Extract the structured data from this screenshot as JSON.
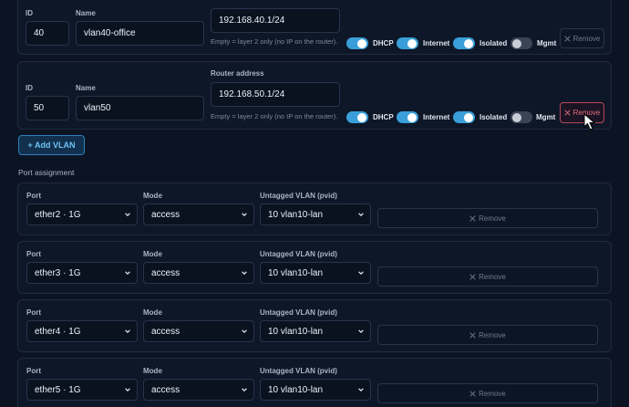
{
  "vlans": [
    {
      "id": "40",
      "name": "vlan40-office",
      "id_label": "ID",
      "name_label": "Name",
      "router_label": "",
      "router_address": "192.168.40.1/24",
      "hint": "Empty = layer 2 only (no IP on the router).",
      "toggles": [
        {
          "label": "DHCP",
          "on": true
        },
        {
          "label": "Internet",
          "on": true
        },
        {
          "label": "Isolated",
          "on": true
        },
        {
          "label": "Mgmt",
          "on": false
        }
      ],
      "remove_label": "Remove"
    },
    {
      "id": "50",
      "name": "vlan50",
      "id_label": "ID",
      "name_label": "Name",
      "router_label": "Router address",
      "router_address": "192.168.50.1/24",
      "hint": "Empty = layer 2 only (no IP on the router).",
      "toggles": [
        {
          "label": "DHCP",
          "on": true
        },
        {
          "label": "Internet",
          "on": true
        },
        {
          "label": "Isolated",
          "on": true
        },
        {
          "label": "Mgmt",
          "on": false
        }
      ],
      "remove_label": "Remove"
    }
  ],
  "add_vlan_label": "+ Add VLAN",
  "port_section_title": "Port assignment",
  "port_labels": {
    "port": "Port",
    "mode": "Mode",
    "pvid": "Untagged VLAN (pvid)"
  },
  "ports": [
    {
      "port": "ether2 · 1G",
      "mode": "access",
      "pvid": "10 vlan10-lan",
      "remove_label": "Remove"
    },
    {
      "port": "ether3 · 1G",
      "mode": "access",
      "pvid": "10 vlan10-lan",
      "remove_label": "Remove"
    },
    {
      "port": "ether4 · 1G",
      "mode": "access",
      "pvid": "10 vlan10-lan",
      "remove_label": "Remove"
    },
    {
      "port": "ether5 · 1G",
      "mode": "access",
      "pvid": "10 vlan10-lan",
      "remove_label": "Remove"
    }
  ],
  "colors": {
    "accent": "#3a9fd8",
    "danger": "#e26a7c",
    "background": "#0c1424"
  }
}
